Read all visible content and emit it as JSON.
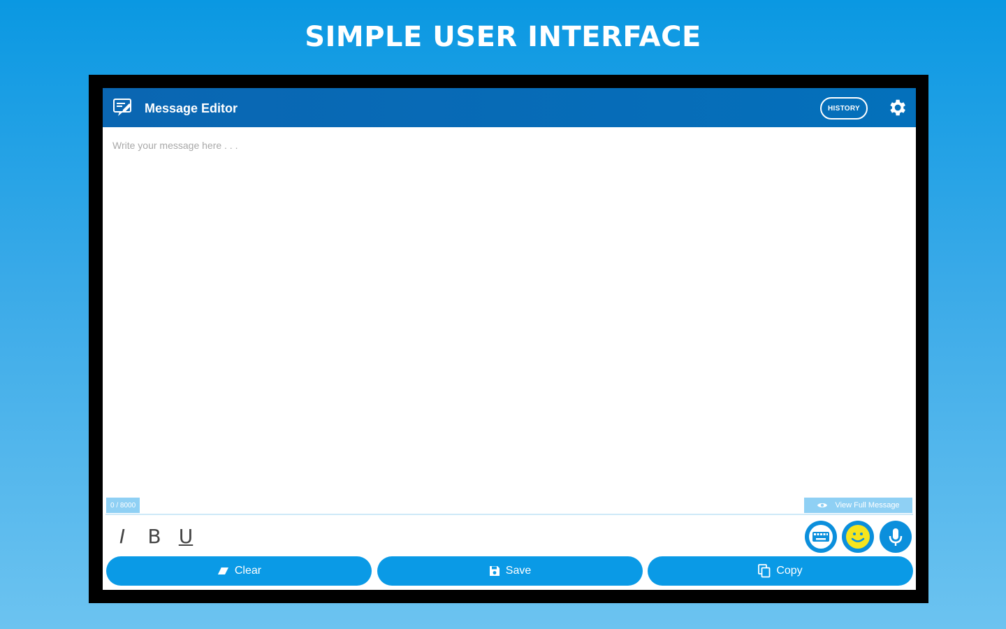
{
  "promo": {
    "title": "SIMPLE USER INTERFACE"
  },
  "app_bar": {
    "icon": "editor-icon",
    "title": "Message Editor",
    "history_label": "HISTORY",
    "settings_icon": "gear-icon"
  },
  "editor": {
    "value": "",
    "placeholder": "Write your message here . . .",
    "counter": "0 / 8000",
    "view_full_label": "View Full Message",
    "view_full_icon": "eye-icon"
  },
  "formatting": {
    "italic": "I",
    "bold": "B",
    "underline": "U"
  },
  "input_modes": [
    "keyboard-icon",
    "emoji-icon",
    "microphone-icon"
  ],
  "actions": {
    "clear": {
      "label": "Clear",
      "icon": "eraser-icon"
    },
    "save": {
      "label": "Save",
      "icon": "floppy-disk-icon"
    },
    "copy": {
      "label": "Copy",
      "icon": "copy-icon"
    }
  },
  "colors": {
    "app_bar": "#0a66b2",
    "accent": "#0a9ae6",
    "badge": "#8fd0f4",
    "emoji_yellow": "#f6e51e"
  }
}
